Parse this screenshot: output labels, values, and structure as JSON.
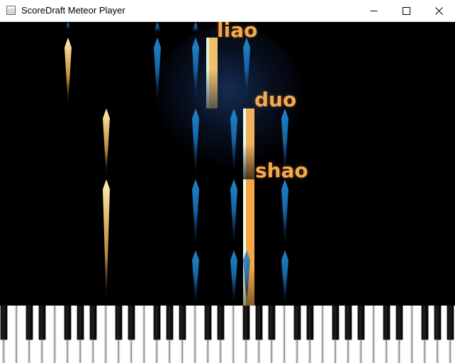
{
  "window": {
    "title": "ScoreDraft Meteor Player",
    "icon": "app-window-icon",
    "controls": [
      "minimize-icon",
      "maximize-icon",
      "close-icon"
    ]
  },
  "colors": {
    "background": "#000000",
    "lyric": "#f5a84c",
    "meteor_blue": "#1f86cc",
    "meteor_gold": "#e8c27a",
    "bar_active": "#f2a64a"
  },
  "lyrics": [
    {
      "text": "liao"
    },
    {
      "text": "duo"
    },
    {
      "text": "shao"
    }
  ],
  "keyboard": {
    "white_keys": 40,
    "black_keys": 28,
    "pressed_keys": [
      "white-key-8",
      "white-key-16",
      "white-key-19"
    ]
  }
}
